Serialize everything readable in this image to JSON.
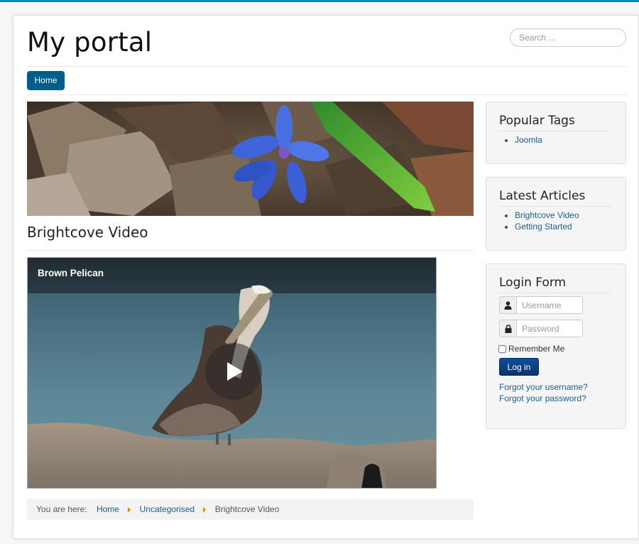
{
  "header": {
    "site_title": "My portal",
    "search_placeholder": "Search ..."
  },
  "nav": {
    "items": [
      {
        "label": "Home"
      }
    ]
  },
  "article": {
    "title": "Brightcove Video",
    "video": {
      "title": "Brown Pelican"
    }
  },
  "breadcrumb": {
    "prefix": "You are here:",
    "items": [
      {
        "label": "Home"
      },
      {
        "label": "Uncategorised"
      },
      {
        "label": "Brightcove Video"
      }
    ]
  },
  "sidebar": {
    "popular_tags": {
      "title": "Popular Tags",
      "items": [
        "Joomla"
      ]
    },
    "latest_articles": {
      "title": "Latest Articles",
      "items": [
        "Brightcove Video",
        "Getting Started"
      ]
    },
    "login_form": {
      "title": "Login Form",
      "username_placeholder": "Username",
      "password_placeholder": "Password",
      "remember_label": "Remember Me",
      "login_button": "Log in",
      "forgot_username": "Forgot your username?",
      "forgot_password": "Forgot your password?"
    }
  },
  "colors": {
    "accent": "#0088cc",
    "nav_active": "#005e8d",
    "link": "#1b5c95",
    "breadcrumb_separator": "#e68a00"
  },
  "icons": [
    "user-icon",
    "lock-icon",
    "play-icon"
  ]
}
